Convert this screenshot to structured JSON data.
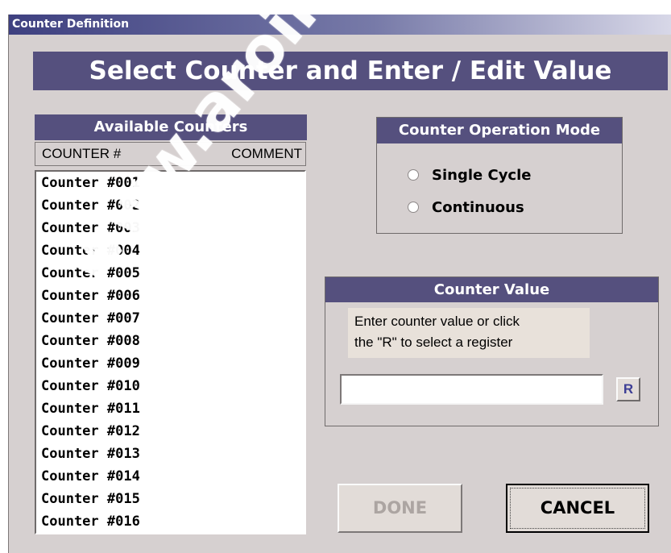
{
  "window": {
    "title": "Counter Definition"
  },
  "banner": {
    "text": "Select Counter and Enter / Edit Value"
  },
  "counters": {
    "title": "Available Counters",
    "col_counter": "COUNTER #",
    "col_comment": "COMMENT",
    "items": [
      "Counter #001",
      "Counter #002",
      "Counter #003",
      "Counter #004",
      "Counter #005",
      "Counter #006",
      "Counter #007",
      "Counter #008",
      "Counter #009",
      "Counter #010",
      "Counter #011",
      "Counter #012",
      "Counter #013",
      "Counter #014",
      "Counter #015",
      "Counter #016"
    ]
  },
  "mode": {
    "title": "Counter Operation Mode",
    "options": [
      "Single Cycle",
      "Continuous"
    ]
  },
  "value": {
    "title": "Counter Value",
    "help_line1": "Enter counter value or click",
    "help_line2": "the \"R\" to select a register",
    "input_value": "",
    "register_button": "R"
  },
  "actions": {
    "done": "DONE",
    "cancel": "CANCEL"
  },
  "watermark": "www.aroil.com"
}
